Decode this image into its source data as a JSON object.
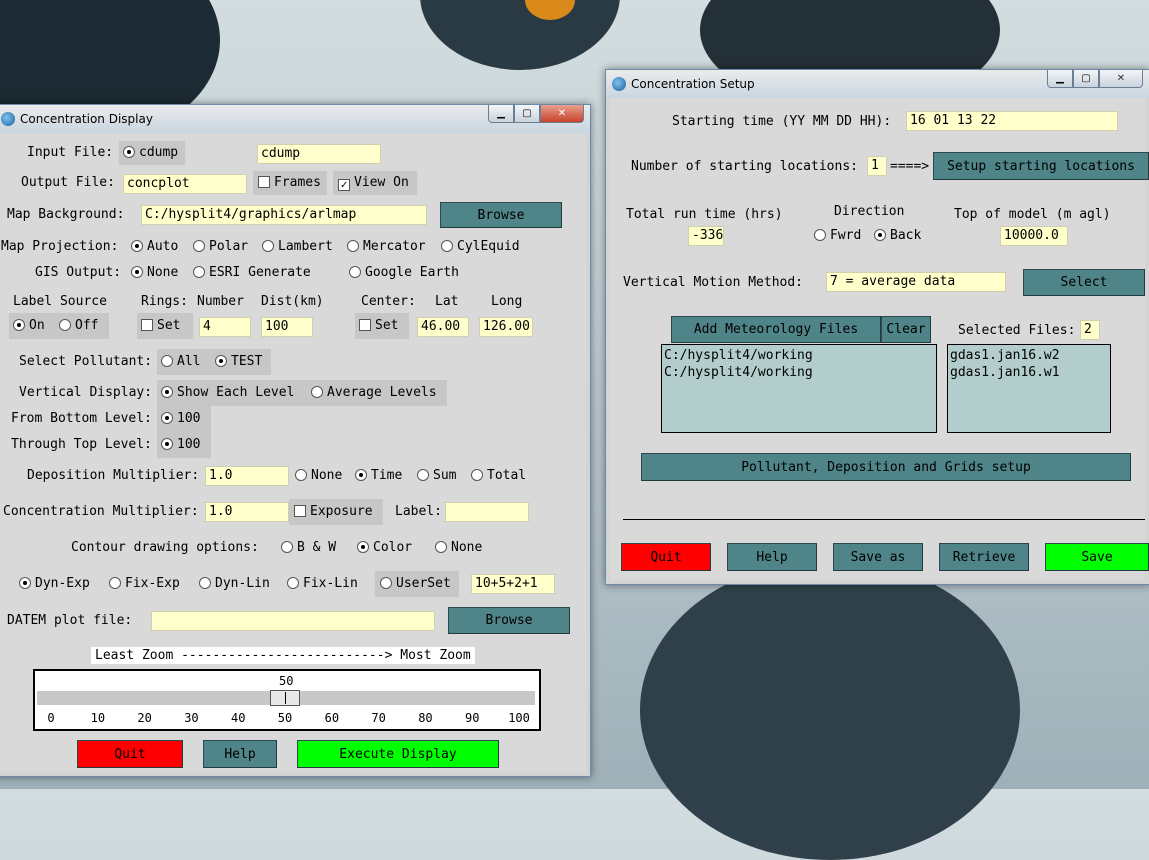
{
  "display": {
    "title": "Concentration Display",
    "input_file_label": "Input File:",
    "input_file_radio": "cdump",
    "input_file_value": "cdump",
    "output_file_label": "Output File:",
    "output_file_value": "concplot",
    "frames_label": "Frames",
    "view_on_label": "View On",
    "map_background_label": "Map Background:",
    "map_background_value": "C:/hysplit4/graphics/arlmap",
    "browse_label": "Browse",
    "map_projection_label": "Map Projection:",
    "proj_auto": "Auto",
    "proj_polar": "Polar",
    "proj_lambert": "Lambert",
    "proj_mercator": "Mercator",
    "proj_cylequid": "CylEquid",
    "gis_output_label": "GIS Output:",
    "gis_none": "None",
    "gis_esri": "ESRI Generate",
    "gis_google": "Google Earth",
    "label_source_label": "Label Source",
    "label_on": "On",
    "label_off": "Off",
    "rings_label": "Rings:",
    "number_label": "Number",
    "dist_label": "Dist(km)",
    "rings_set": "Set",
    "rings_number": "4",
    "rings_dist": "100",
    "center_label": "Center:",
    "lat_label": "Lat",
    "long_label": "Long",
    "center_set": "Set",
    "center_lat": "46.00",
    "center_long": "126.00",
    "select_pollutant_label": "Select Pollutant:",
    "poll_all": "All",
    "poll_test": "TEST",
    "vertical_display_label": "Vertical Display:",
    "show_each_level": "Show Each Level",
    "average_levels": "Average Levels",
    "from_bottom_label": "From Bottom Level:",
    "from_bottom_value": "100",
    "through_top_label": "Through Top Level:",
    "through_top_value": "100",
    "deposition_label": "Deposition Multiplier:",
    "deposition_value": "1.0",
    "dep_none": "None",
    "dep_time": "Time",
    "dep_sum": "Sum",
    "dep_total": "Total",
    "concentration_label": "Concentration Multiplier:",
    "concentration_value": "1.0",
    "exposure_label": "Exposure",
    "label_label": "Label:",
    "label_value": "",
    "contour_label": "Contour drawing options:",
    "contour_bw": "B & W",
    "contour_color": "Color",
    "contour_none": "None",
    "dyn_exp": "Dyn-Exp",
    "fix_exp": "Fix-Exp",
    "dyn_lin": "Dyn-Lin",
    "fix_lin": "Fix-Lin",
    "userset": "UserSet",
    "userset_value": "10+5+2+1",
    "datem_label": "DATEM plot file:",
    "datem_value": "",
    "datem_browse": "Browse",
    "zoom_label": "Least Zoom --------------------------> Most Zoom",
    "zoom_value": 50,
    "zoom_value_text": "50",
    "zoom_ticks": [
      "0",
      "10",
      "20",
      "30",
      "40",
      "50",
      "60",
      "70",
      "80",
      "90",
      "100"
    ],
    "quit": "Quit",
    "help": "Help",
    "execute": "Execute Display"
  },
  "setup": {
    "title": "Concentration Setup",
    "starting_time_label": "Starting time (YY MM DD HH):",
    "starting_time_value": "16 01 13 22",
    "num_locations_label": "Number of starting locations:",
    "num_locations_value": "1",
    "arrow": "====>",
    "setup_locations": "Setup starting locations",
    "run_time_label": "Total run time (hrs)",
    "run_time_value": "-336",
    "direction_label": "Direction",
    "fwrd": "Fwrd",
    "back": "Back",
    "top_model_label": "Top of model (m agl)",
    "top_model_value": "10000.0",
    "vertical_motion_label": "Vertical Motion Method:",
    "vertical_motion_value": "7 = average data",
    "select": "Select",
    "add_met": "Add Meteorology Files",
    "clear": "Clear",
    "selected_files_label": "Selected Files:",
    "selected_files_value": "2",
    "dirs": [
      "C:/hysplit4/working",
      "C:/hysplit4/working"
    ],
    "files": [
      "gdas1.jan16.w2",
      "gdas1.jan16.w1"
    ],
    "pollutant_setup": "Pollutant, Deposition and Grids setup",
    "quit": "Quit",
    "help": "Help",
    "save_as": "Save as",
    "retrieve": "Retrieve",
    "save": "Save"
  },
  "colors": {
    "teal_button": "#4f8488",
    "quit_red": "#ff0000",
    "go_green": "#00ff00",
    "field_yellow": "#ffffcc"
  }
}
